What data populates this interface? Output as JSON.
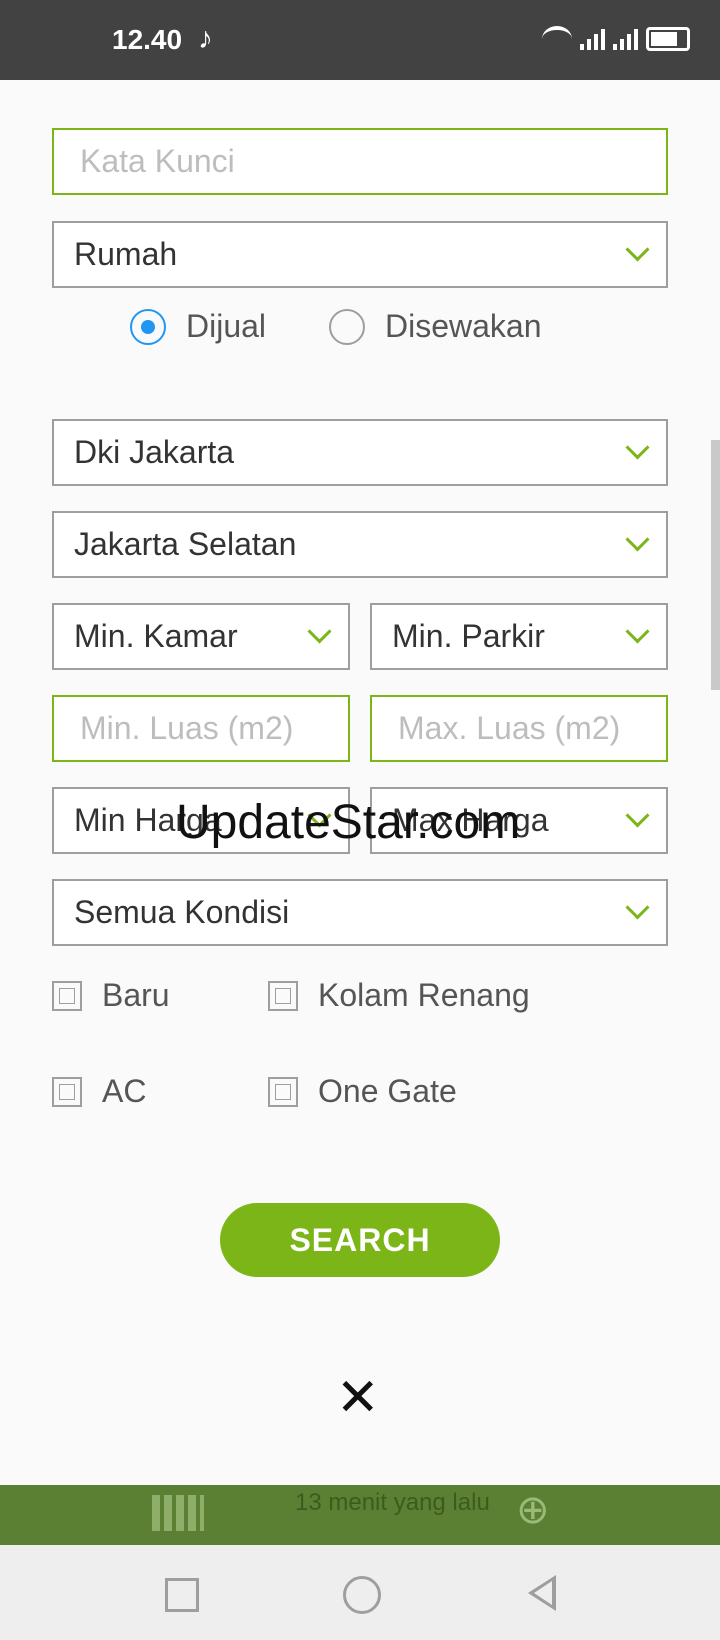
{
  "status_bar": {
    "time": "12.40"
  },
  "form": {
    "keyword_placeholder": "Kata Kunci",
    "property_type": "Rumah",
    "listing_options": [
      {
        "label": "Dijual",
        "selected": true
      },
      {
        "label": "Disewakan",
        "selected": false
      }
    ],
    "province": "Dki Jakarta",
    "city": "Jakarta Selatan",
    "min_rooms": "Min. Kamar",
    "min_parking": "Min. Parkir",
    "min_area_placeholder": "Min. Luas (m2)",
    "max_area_placeholder": "Max. Luas (m2)",
    "min_price": "Min Harga",
    "max_price": "Max Harga",
    "condition": "Semua Kondisi",
    "checkboxes": [
      "Baru",
      "Kolam Renang",
      "AC",
      "One Gate"
    ],
    "search_label": "SEARCH",
    "close_symbol": "✕"
  },
  "watermark": "UpdateStar.com",
  "background": {
    "time_ago": "13 menit yang lalu"
  },
  "colors": {
    "accent": "#7cb518",
    "radio": "#2196f3"
  }
}
